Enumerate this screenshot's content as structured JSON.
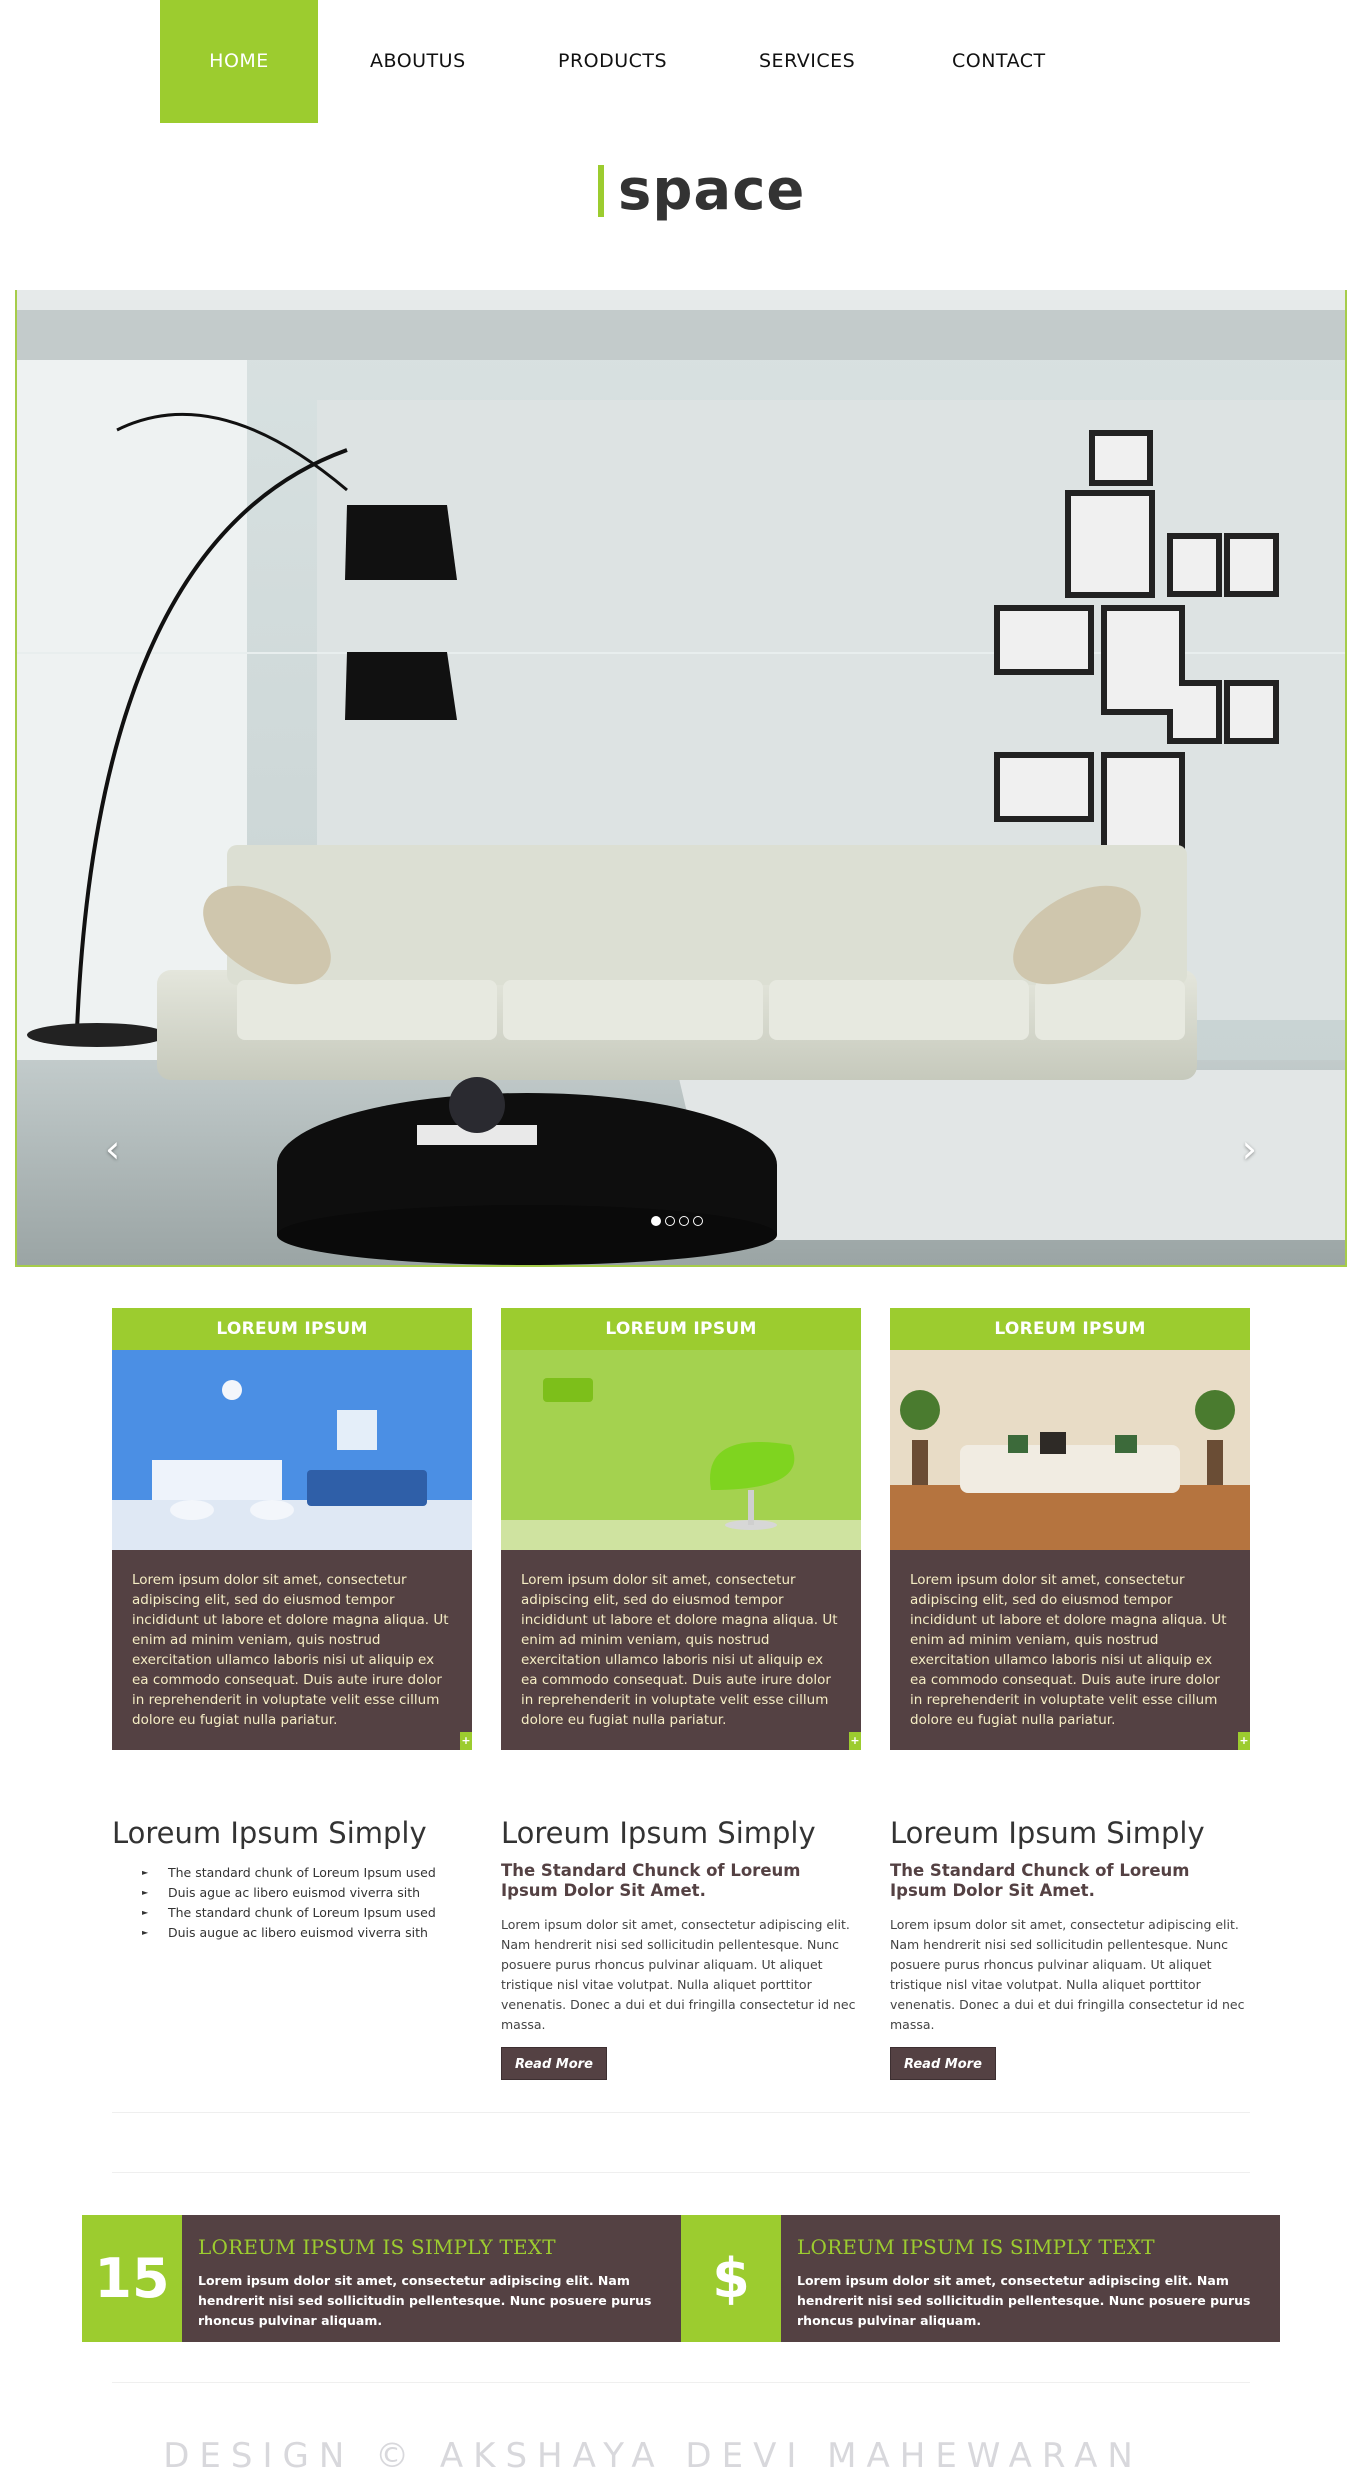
{
  "nav": {
    "items": [
      "HOME",
      "ABOUTUS",
      "PRODUCTS",
      "SERVICES",
      "CONTACT"
    ],
    "active_color": "#9ccc2f"
  },
  "logo": {
    "text": "space"
  },
  "slider": {
    "prev_icon": "‹",
    "next_icon": "›",
    "dot_count": 4,
    "active_dot": 1
  },
  "cards": [
    {
      "title": "LOREUM IPSUM",
      "image": "blue-dining-room",
      "text": "Lorem ipsum dolor sit amet, consectetur adipiscing elit, sed do eiusmod tempor incididunt ut labore et dolore magna aliqua. Ut enim ad minim veniam, quis nostrud exercitation ullamco laboris nisi ut aliquip ex ea commodo consequat. Duis aute irure dolor in reprehenderit in voluptate velit esse cillum dolore eu fugiat nulla pariatur.",
      "plus": "+"
    },
    {
      "title": "LOREUM IPSUM",
      "image": "green-chair-room",
      "text": "Lorem ipsum dolor sit amet, consectetur adipiscing elit, sed do eiusmod tempor incididunt ut labore et dolore magna aliqua. Ut enim ad minim veniam, quis nostrud exercitation ullamco laboris nisi ut aliquip ex ea commodo consequat. Duis aute irure dolor in reprehenderit in voluptate velit esse cillum dolore eu fugiat nulla pariatur.",
      "plus": "+"
    },
    {
      "title": "LOREUM IPSUM",
      "image": "beige-sofa-room",
      "text": "Lorem ipsum dolor sit amet, consectetur adipiscing elit, sed do eiusmod tempor incididunt ut labore et dolore magna aliqua. Ut enim ad minim veniam, quis nostrud exercitation ullamco laboris nisi ut aliquip ex ea commodo consequat. Duis aute irure dolor in reprehenderit in voluptate velit esse cillum dolore eu fugiat nulla pariatur.",
      "plus": "+"
    }
  ],
  "columns": {
    "col1": {
      "title": "Loreum Ipsum Simply",
      "list": [
        "The standard chunk of Loreum Ipsum used",
        "Duis ague ac libero euismod viverra sith",
        "The standard chunk of Loreum Ipsum used",
        "Duis augue ac libero euismod viverra sith"
      ]
    },
    "col2": {
      "title": "Loreum Ipsum Simply",
      "subtitle": "The Standard Chunck of Loreum Ipsum Dolor Sit Amet.",
      "body": "Lorem ipsum dolor sit amet, consectetur adipiscing elit. Nam hendrerit nisi sed sollicitudin pellentesque. Nunc posuere purus rhoncus pulvinar aliquam. Ut aliquet tristique nisl vitae volutpat. Nulla aliquet porttitor venenatis. Donec a dui et dui fringilla consectetur id nec massa.",
      "button": "Read More"
    },
    "col3": {
      "title": "Loreum Ipsum Simply",
      "subtitle": "The Standard Chunck of Loreum Ipsum Dolor Sit Amet.",
      "body": "Lorem ipsum dolor sit amet, consectetur adipiscing elit. Nam hendrerit nisi sed sollicitudin pellentesque. Nunc posuere purus rhoncus pulvinar aliquam. Ut aliquet tristique nisl vitae volutpat. Nulla aliquet porttitor venenatis. Donec a dui et dui fringilla consectetur id nec massa.",
      "button": "Read More"
    }
  },
  "features": [
    {
      "badge": "15",
      "title": "LOREUM IPSUM IS SIMPLY TEXT",
      "body": "Lorem ipsum dolor sit amet, consectetur adipiscing elit. Nam hendrerit nisi sed sollicitudin pellentesque. Nunc posuere purus rhoncus pulvinar aliquam."
    },
    {
      "badge": "$",
      "title": "LOREUM IPSUM IS SIMPLY TEXT",
      "body": "Lorem ipsum dolor sit amet, consectetur adipiscing elit. Nam hendrerit nisi sed sollicitudin pellentesque. Nunc posuere purus rhoncus pulvinar aliquam."
    }
  ],
  "footer": {
    "text": "DESIGN © AKSHAYA DEVI MAHEWARAN"
  },
  "colors": {
    "green": "#9ccc2f",
    "brown": "#544143",
    "cream": "#f5edc4"
  }
}
